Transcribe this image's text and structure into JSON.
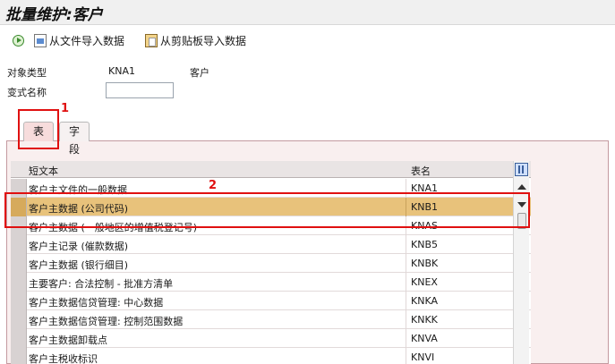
{
  "header": {
    "title": "批量维护:客户"
  },
  "toolbar": {
    "import_file_label": "从文件导入数据",
    "import_clipboard_label": "从剪贴板导入数据"
  },
  "form": {
    "object_type_label": "对象类型",
    "object_type_value": "KNA1",
    "object_type_desc": "客户",
    "variant_label": "变式名称",
    "variant_value": ""
  },
  "tabs": [
    {
      "label": "表",
      "active": true
    },
    {
      "label": "字段",
      "active": false
    }
  ],
  "table": {
    "columns": [
      "短文本",
      "表名"
    ],
    "rows": [
      {
        "text": "客户主文件的一般数据",
        "name": "KNA1"
      },
      {
        "text": "客户主数据 (公司代码)",
        "name": "KNB1",
        "selected": true
      },
      {
        "text": "客户主数据 (一般地区的增值税登记号)",
        "name": "KNAS"
      },
      {
        "text": "客户主记录 (催款数据)",
        "name": "KNB5"
      },
      {
        "text": "客户主数据 (银行细目)",
        "name": "KNBK"
      },
      {
        "text": "主要客户: 合法控制 - 批准方清单",
        "name": "KNEX"
      },
      {
        "text": "客户主数据信贷管理: 中心数据",
        "name": "KNKA"
      },
      {
        "text": "客户主数据信贷管理: 控制范围数据",
        "name": "KNKK"
      },
      {
        "text": "客户主数据卸载点",
        "name": "KNVA"
      },
      {
        "text": "客户主税收标识",
        "name": "KNVI"
      }
    ]
  },
  "annotations": {
    "label_1": "1",
    "label_2": "2"
  },
  "colors": {
    "highlight": "#e8c27b",
    "annotation": "#e01010",
    "tab_active": "#f7dcdc"
  }
}
